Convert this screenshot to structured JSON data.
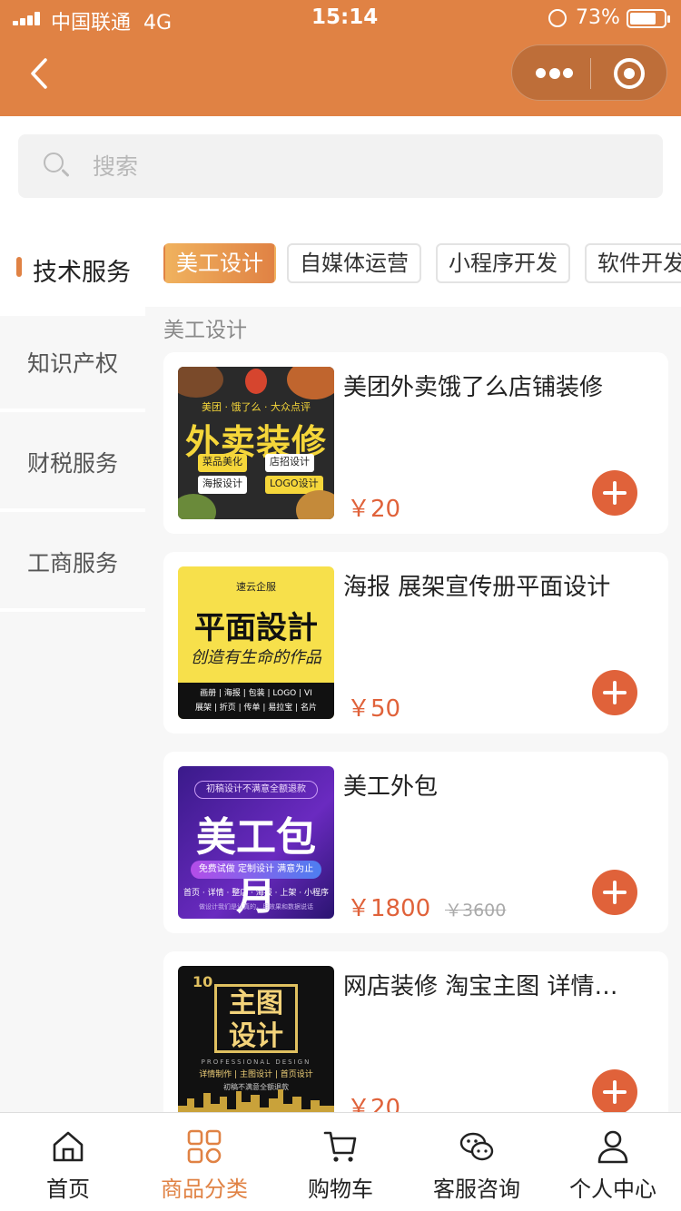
{
  "status_bar": {
    "carrier": "中国联通",
    "network": "4G",
    "time": "15:14",
    "battery": "73%"
  },
  "search": {
    "placeholder": "搜索"
  },
  "sidebar": {
    "items": [
      {
        "label": "技术服务",
        "active": true
      },
      {
        "label": "知识产权",
        "active": false
      },
      {
        "label": "财税服务",
        "active": false
      },
      {
        "label": "工商服务",
        "active": false
      }
    ]
  },
  "subcategory_tabs": [
    {
      "label": "美工设计",
      "active": true
    },
    {
      "label": "自媒体运营",
      "active": false
    },
    {
      "label": "小程序开发",
      "active": false
    },
    {
      "label": "软件开发",
      "active": false
    }
  ],
  "section_title": "美工设计",
  "products": [
    {
      "title": "美团外卖饿了么店铺装修",
      "price": "￥20",
      "original_price": "",
      "thumb": {
        "banner": "美团 · 饿了么 · 大众点评",
        "big": "外卖装修",
        "chips": [
          "菜品美化",
          "店招设计",
          "海报设计",
          "LOGO设计"
        ]
      }
    },
    {
      "title": "海报 展架宣传册平面设计",
      "price": "￥50",
      "original_price": "",
      "thumb": {
        "brand": "速云企服",
        "big": "平面設計",
        "script": "创造有生命的作品",
        "line1": "画册 | 海报 | 包装 | LOGO | VI",
        "line2": "展架 | 折页 | 传单 | 易拉宝 | 名片"
      }
    },
    {
      "title": "美工外包",
      "price": "￥1800",
      "original_price": "￥3600",
      "thumb": {
        "top": "初稿设计不满意全额退款",
        "big": "美工包月",
        "pill": "免费试做 定制设计 满意为止",
        "line": "首页 · 详情 · 整店 · 海报 · 上架 · 小程序",
        "small": "做设计我们是认真的，用效果和数据说话"
      }
    },
    {
      "title": "网店装修 淘宝主图 详情…",
      "price": "￥20",
      "original_price": "",
      "thumb": {
        "badge": "10",
        "big_line1": "主图",
        "big_line2": "设计",
        "pro": "PROFESSIONAL DESIGN",
        "tags": "详情制作 | 主图设计 | 首页设计",
        "note": "初稿不满意全额退款"
      }
    }
  ],
  "tabbar": [
    {
      "label": "首页",
      "icon": "home-icon",
      "active": false
    },
    {
      "label": "商品分类",
      "icon": "category-icon",
      "active": true
    },
    {
      "label": "购物车",
      "icon": "cart-icon",
      "active": false
    },
    {
      "label": "客服咨询",
      "icon": "chat-icon",
      "active": false
    },
    {
      "label": "个人中心",
      "icon": "user-icon",
      "active": false
    }
  ],
  "colors": {
    "brand": "#e08244",
    "price": "#e0623a",
    "active_tab_gradient": [
      "#f0b25e",
      "#e08244"
    ]
  }
}
